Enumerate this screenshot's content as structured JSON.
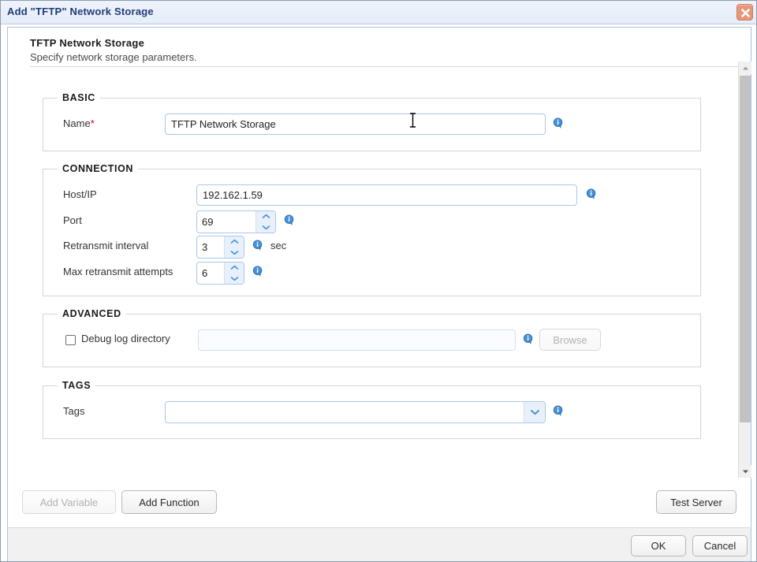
{
  "window": {
    "title": "Add \"TFTP\" Network Storage",
    "close_icon": "close-x-icon"
  },
  "header": {
    "title": "TFTP Network Storage",
    "subtitle": "Specify network storage parameters."
  },
  "sections": {
    "basic": {
      "legend": "BASIC",
      "name": {
        "label": "Name",
        "required_marker": "*",
        "value": "TFTP Network Storage",
        "placeholder": "",
        "info_icon": "info-icon"
      }
    },
    "connection": {
      "legend": "CONNECTION",
      "host": {
        "label": "Host/IP",
        "value": "192.162.1.59",
        "placeholder": "",
        "info_icon": "info-icon"
      },
      "port": {
        "label": "Port",
        "value": "69",
        "info_icon": "info-icon",
        "up_icon": "chevron-up-icon",
        "down_icon": "chevron-down-icon"
      },
      "retransmit_interval": {
        "label": "Retransmit interval",
        "value": "3",
        "unit": "sec",
        "info_icon": "info-icon",
        "up_icon": "chevron-up-icon",
        "down_icon": "chevron-down-icon"
      },
      "max_retransmit_attempts": {
        "label": "Max retransmit attempts",
        "value": "6",
        "info_icon": "info-icon",
        "up_icon": "chevron-up-icon",
        "down_icon": "chevron-down-icon"
      }
    },
    "advanced": {
      "legend": "ADVANCED",
      "debug_log_directory": {
        "label": "Debug log directory",
        "checked": false,
        "value": "",
        "placeholder": "",
        "disabled": true,
        "info_icon": "info-icon",
        "browse_label": "Browse",
        "browse_disabled": true
      }
    },
    "tags": {
      "legend": "TAGS",
      "tags_field": {
        "label": "Tags",
        "value": "",
        "placeholder": "",
        "dropdown_icon": "chevron-down-icon",
        "info_icon": "info-icon"
      }
    }
  },
  "actions": {
    "add_variable": {
      "label": "Add Variable",
      "disabled": true
    },
    "add_function": {
      "label": "Add Function",
      "disabled": false
    },
    "test_server": {
      "label": "Test Server",
      "disabled": false
    }
  },
  "footer": {
    "ok": {
      "label": "OK"
    },
    "cancel": {
      "label": "Cancel"
    }
  },
  "scrollbar": {
    "up_icon": "scroll-up-arrow-icon",
    "down_icon": "scroll-down-arrow-icon"
  },
  "colors": {
    "titlebar_text": "#1f3c78",
    "required_asterisk": "#d0021b",
    "input_border": "#a8c8ea",
    "close_button": "#e8967a",
    "info_icon": "#2a6fb5"
  }
}
